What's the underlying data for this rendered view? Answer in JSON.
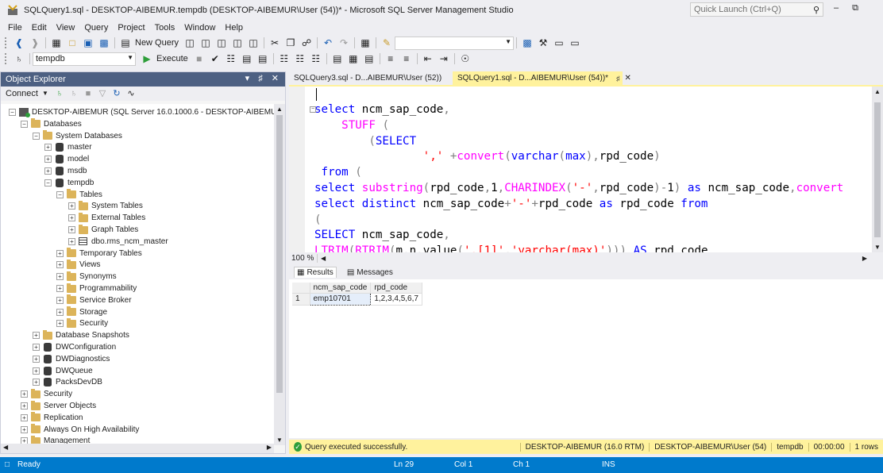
{
  "window": {
    "title": "SQLQuery1.sql - DESKTOP-AIBEMUR.tempdb (DESKTOP-AIBEMUR\\User (54))* - Microsoft SQL Server Management Studio",
    "quick_launch_placeholder": "Quick Launch (Ctrl+Q)"
  },
  "menu": [
    "File",
    "Edit",
    "View",
    "Query",
    "Project",
    "Tools",
    "Window",
    "Help"
  ],
  "toolbar": {
    "new_query": "New Query",
    "execute": "Execute",
    "database": "tempdb"
  },
  "object_explorer": {
    "title": "Object Explorer",
    "connect": "Connect",
    "tree": [
      {
        "label": "DESKTOP-AIBEMUR (SQL Server 16.0.1000.6 - DESKTOP-AIBEMUR\\Use",
        "icon": "server",
        "expander": "−"
      },
      {
        "label": "Databases",
        "icon": "folder",
        "expander": "−"
      },
      {
        "label": "System Databases",
        "icon": "folder",
        "expander": "−"
      },
      {
        "label": "master",
        "icon": "database",
        "expander": "+"
      },
      {
        "label": "model",
        "icon": "database",
        "expander": "+"
      },
      {
        "label": "msdb",
        "icon": "database",
        "expander": "+"
      },
      {
        "label": "tempdb",
        "icon": "database",
        "expander": "−"
      },
      {
        "label": "Tables",
        "icon": "folder",
        "expander": "−"
      },
      {
        "label": "System Tables",
        "icon": "folder",
        "expander": "+"
      },
      {
        "label": "External Tables",
        "icon": "folder",
        "expander": "+"
      },
      {
        "label": "Graph Tables",
        "icon": "folder",
        "expander": "+"
      },
      {
        "label": "dbo.rms_ncm_master",
        "icon": "table",
        "expander": "+"
      },
      {
        "label": "Temporary Tables",
        "icon": "folder",
        "expander": "+"
      },
      {
        "label": "Views",
        "icon": "folder",
        "expander": "+"
      },
      {
        "label": "Synonyms",
        "icon": "folder",
        "expander": "+"
      },
      {
        "label": "Programmability",
        "icon": "folder",
        "expander": "+"
      },
      {
        "label": "Service Broker",
        "icon": "folder",
        "expander": "+"
      },
      {
        "label": "Storage",
        "icon": "folder",
        "expander": "+"
      },
      {
        "label": "Security",
        "icon": "folder",
        "expander": "+"
      },
      {
        "label": "Database Snapshots",
        "icon": "folder",
        "expander": "+"
      },
      {
        "label": "DWConfiguration",
        "icon": "database",
        "expander": "+"
      },
      {
        "label": "DWDiagnostics",
        "icon": "database",
        "expander": "+"
      },
      {
        "label": "DWQueue",
        "icon": "database",
        "expander": "+"
      },
      {
        "label": "PacksDevDB",
        "icon": "database",
        "expander": "+"
      },
      {
        "label": "Security",
        "icon": "folder",
        "expander": "+"
      },
      {
        "label": "Server Objects",
        "icon": "folder",
        "expander": "+"
      },
      {
        "label": "Replication",
        "icon": "folder",
        "expander": "+"
      },
      {
        "label": "Always On High Availability",
        "icon": "folder",
        "expander": "+"
      },
      {
        "label": "Management",
        "icon": "folder",
        "expander": "+"
      }
    ]
  },
  "tabs": [
    {
      "label": "SQLQuery3.sql - D...AIBEMUR\\User (52))",
      "active": false
    },
    {
      "label": "SQLQuery1.sql - D...AIBEMUR\\User (54))*",
      "active": true
    }
  ],
  "editor": {
    "zoom": "100 %",
    "lines": [
      "select ncm_sap_code,",
      "    STUFF (",
      "        (SELECT",
      "                ',' +convert(varchar(max),rpd_code)",
      " from (",
      "select substring(rpd_code,1,CHARINDEX('-',rpd_code)-1) as ncm_sap_code,convert",
      "select distinct ncm_sap_code+'-'+rpd_code as rpd_code from",
      "(",
      "SELECT ncm_sap_code,",
      "LTRIM(RTRIM(m.n.value('.[1]','varchar(max)'))) AS rpd_code"
    ]
  },
  "results": {
    "tab_results": "Results",
    "tab_messages": "Messages",
    "columns": [
      "ncm_sap_code",
      "rpd_code"
    ],
    "rows": [
      {
        "num": "1",
        "ncm_sap_code": "emp10701",
        "rpd_code": "1,2,3,4,5,6,7"
      }
    ]
  },
  "query_status": {
    "message": "Query executed successfully.",
    "server": "DESKTOP-AIBEMUR (16.0 RTM)",
    "user": "DESKTOP-AIBEMUR\\User (54)",
    "database": "tempdb",
    "time": "00:00:00",
    "rows": "1 rows"
  },
  "statusbar": {
    "ready": "Ready",
    "ln": "Ln 29",
    "col": "Col 1",
    "ch": "Ch 1",
    "ins": "INS"
  },
  "colors": {
    "accent": "#007acc",
    "tab_active": "#fff29d",
    "oe_header": "#4d6082"
  }
}
